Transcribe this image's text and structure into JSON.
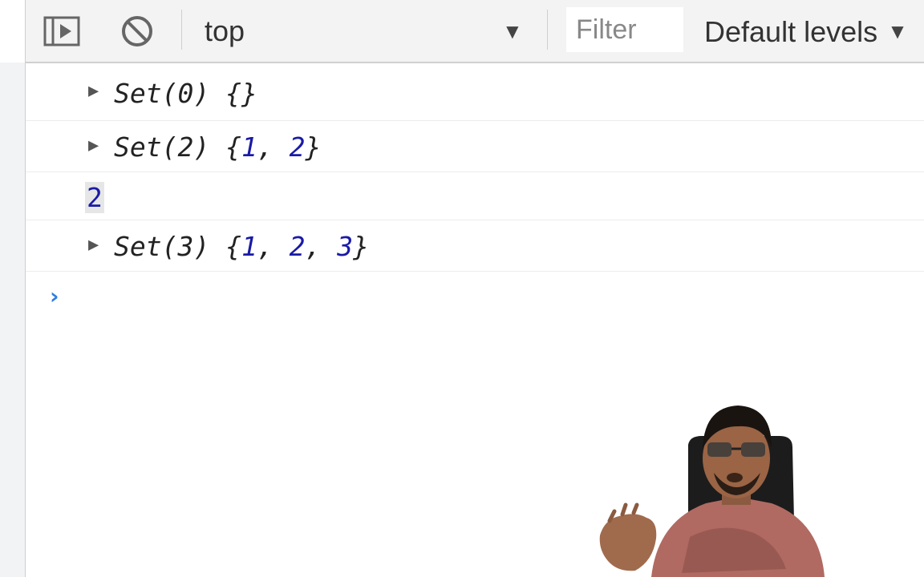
{
  "toolbar": {
    "sidebar_toggle_icon": "sidebar-toggle-icon",
    "clear_icon": "clear-console-icon",
    "context": "top",
    "context_arrow": "▼",
    "filter_placeholder": "Filter",
    "levels_label": "Default levels",
    "levels_arrow": "▼"
  },
  "console": {
    "rows": [
      {
        "expand": "▶",
        "label": "Set(0) {}"
      },
      {
        "expand": "▶",
        "prefix": "Set(2) {",
        "values": [
          "1",
          "2"
        ],
        "suffix": "}"
      },
      {
        "value": "2"
      },
      {
        "expand": "▶",
        "prefix": "Set(3) {",
        "values": [
          "1",
          "2",
          "3"
        ],
        "suffix": "}"
      }
    ],
    "prompt": "›"
  },
  "colors": {
    "number": "#1a1aa6",
    "prompt": "#2f7de1",
    "toolbar_bg": "#f3f3f3"
  }
}
